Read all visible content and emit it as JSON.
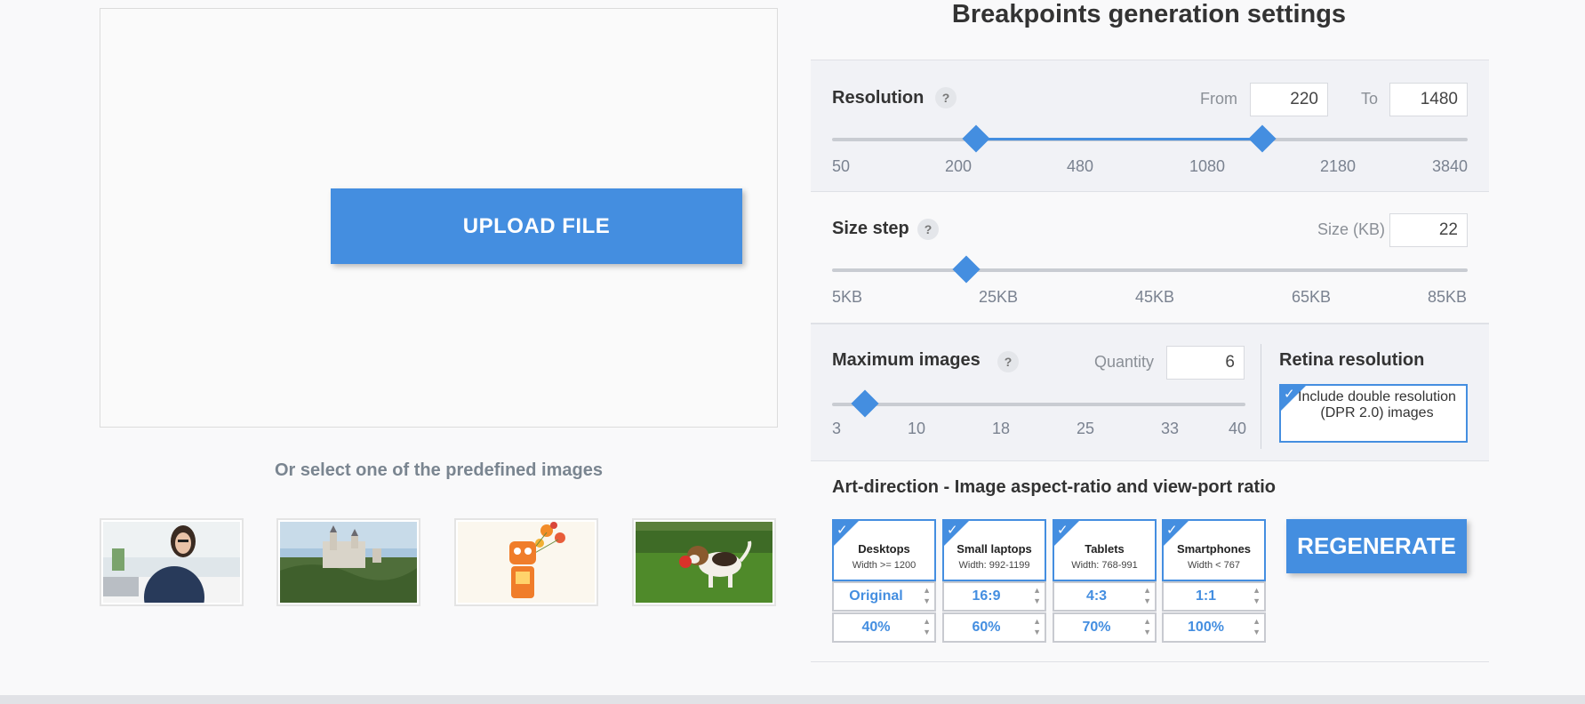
{
  "upload": {
    "button_label": "UPLOAD FILE"
  },
  "predefined": {
    "title": "Or select one of the predefined images",
    "images": [
      {
        "icon": "woman-at-laptop-photo"
      },
      {
        "icon": "castle-photo"
      },
      {
        "icon": "robot-with-flowers-illustration"
      },
      {
        "icon": "puppy-on-grass-photo"
      }
    ]
  },
  "settings": {
    "title": "Breakpoints generation settings",
    "help_glyph": "?",
    "resolution": {
      "label": "Resolution",
      "from_label": "From",
      "from_value": "220",
      "to_label": "To",
      "to_value": "1480",
      "ticks": [
        "50",
        "200",
        "480",
        "1080",
        "2180",
        "3840"
      ],
      "range_from": 220,
      "range_to": 1480
    },
    "size_step": {
      "label": "Size step",
      "size_label": "Size (KB)",
      "size_value": "22",
      "ticks": [
        "5KB",
        "25KB",
        "45KB",
        "65KB",
        "85KB"
      ],
      "value": 22
    },
    "max_images": {
      "label": "Maximum images",
      "quantity_label": "Quantity",
      "quantity_value": "6",
      "ticks": [
        "3",
        "10",
        "18",
        "25",
        "33",
        "40"
      ],
      "value": 6
    },
    "retina": {
      "label": "Retina resolution",
      "checkbox_label": "Include double resolution (DPR 2.0) images",
      "checked": true
    }
  },
  "art_direction": {
    "title": "Art-direction - Image aspect-ratio and view-port ratio",
    "devices": [
      {
        "name": "Desktops",
        "size": "Width >= 1200",
        "ratio": "Original",
        "viewport": "40%",
        "checked": true
      },
      {
        "name": "Small laptops",
        "size": "Width: 992-1199",
        "ratio": "16:9",
        "viewport": "60%",
        "checked": true
      },
      {
        "name": "Tablets",
        "size": "Width: 768-991",
        "ratio": "4:3",
        "viewport": "70%",
        "checked": true
      },
      {
        "name": "Smartphones",
        "size": "Width < 767",
        "ratio": "1:1",
        "viewport": "100%",
        "checked": true
      }
    ],
    "regenerate_label": "REGENERATE"
  },
  "colors": {
    "accent": "#448ee0",
    "muted_text": "#7a8590"
  }
}
